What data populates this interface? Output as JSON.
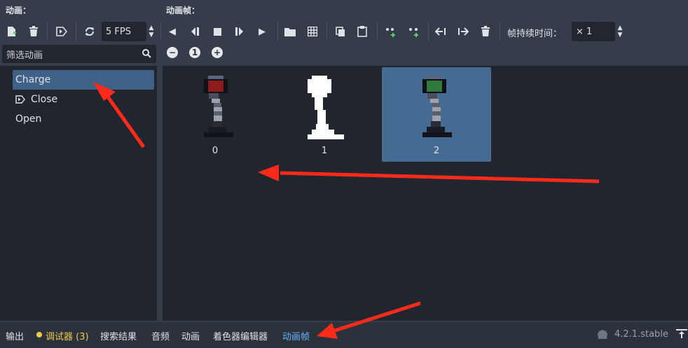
{
  "anim_panel": {
    "title": "动画：",
    "fps_value": "5 FPS",
    "filter_placeholder": "筛选动画",
    "animations": [
      {
        "label": "Charge",
        "selected": true,
        "autoplay": false
      },
      {
        "label": "Close",
        "selected": false,
        "autoplay": true
      },
      {
        "label": "Open",
        "selected": false,
        "autoplay": false
      }
    ]
  },
  "frames_panel": {
    "title": "动画帧：",
    "duration_label": "帧持续时间：",
    "duration_value": "× 1",
    "frames": [
      {
        "label": "0",
        "selected": false,
        "lamp_color": "#8f1c1c"
      },
      {
        "label": "1",
        "selected": false,
        "lamp_color": "#ffffff"
      },
      {
        "label": "2",
        "selected": true,
        "lamp_color": "#2f7a3a"
      }
    ]
  },
  "bottom_bar": {
    "tabs": [
      "输出",
      "调试器 (3)",
      "搜索结果",
      "音频",
      "动画",
      "着色器编辑器",
      "动画帧"
    ],
    "active_tab": "动画帧",
    "debugger_color": "#f0c94c",
    "active_color": "#66b3ff",
    "version": "4.2.1.stable"
  },
  "colors": {
    "accent_selected": "#3f6186",
    "annotation_arrow": "#ff2a1a"
  }
}
